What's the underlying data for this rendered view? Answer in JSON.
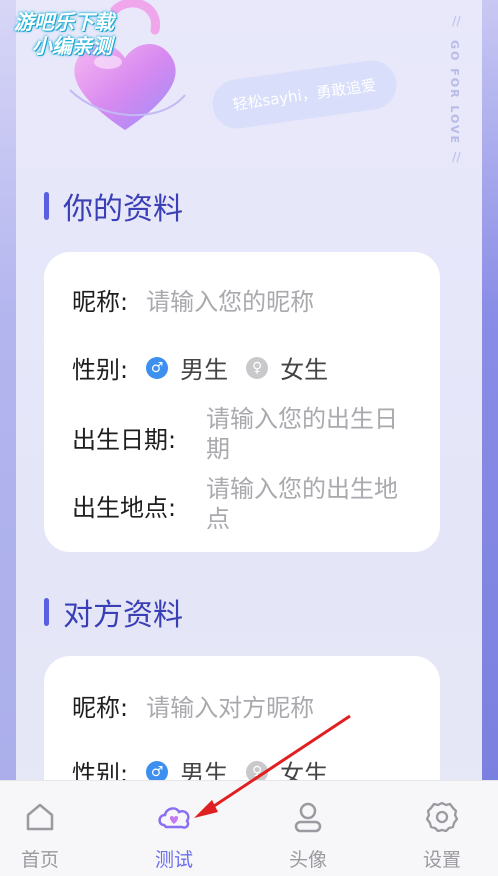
{
  "watermark": {
    "line1": "游吧乐下载",
    "line2": "小编亲测"
  },
  "header": {
    "tagline": "轻松sayhi，勇敢追爱",
    "vertical_text": "GO FOR LOVE",
    "slashes": "//"
  },
  "your_profile": {
    "title": "你的资料",
    "nickname_label": "昵称:",
    "nickname_placeholder": "请输入您的昵称",
    "gender_label": "性别:",
    "gender_male": "男生",
    "gender_female": "女生",
    "birthdate_label": "出生日期:",
    "birthdate_placeholder": "请输入您的出生日期",
    "birthplace_label": "出生地点:",
    "birthplace_placeholder": "请输入您的出生地点"
  },
  "partner_profile": {
    "title": "对方资料",
    "nickname_label": "昵称:",
    "nickname_placeholder": "请输入对方昵称",
    "gender_label": "性别:",
    "gender_male": "男生",
    "gender_female": "女生"
  },
  "tabbar": {
    "tabs": [
      {
        "label": "首页",
        "icon": "home-icon"
      },
      {
        "label": "测试",
        "icon": "heart-cloud-icon",
        "active": true
      },
      {
        "label": "头像",
        "icon": "user-icon"
      },
      {
        "label": "设置",
        "icon": "gear-icon"
      }
    ]
  },
  "colors": {
    "accent": "#6c6ff0",
    "title": "#3a3fb6",
    "radio_selected": "#3d8ff0",
    "arrow": "#e02020"
  }
}
